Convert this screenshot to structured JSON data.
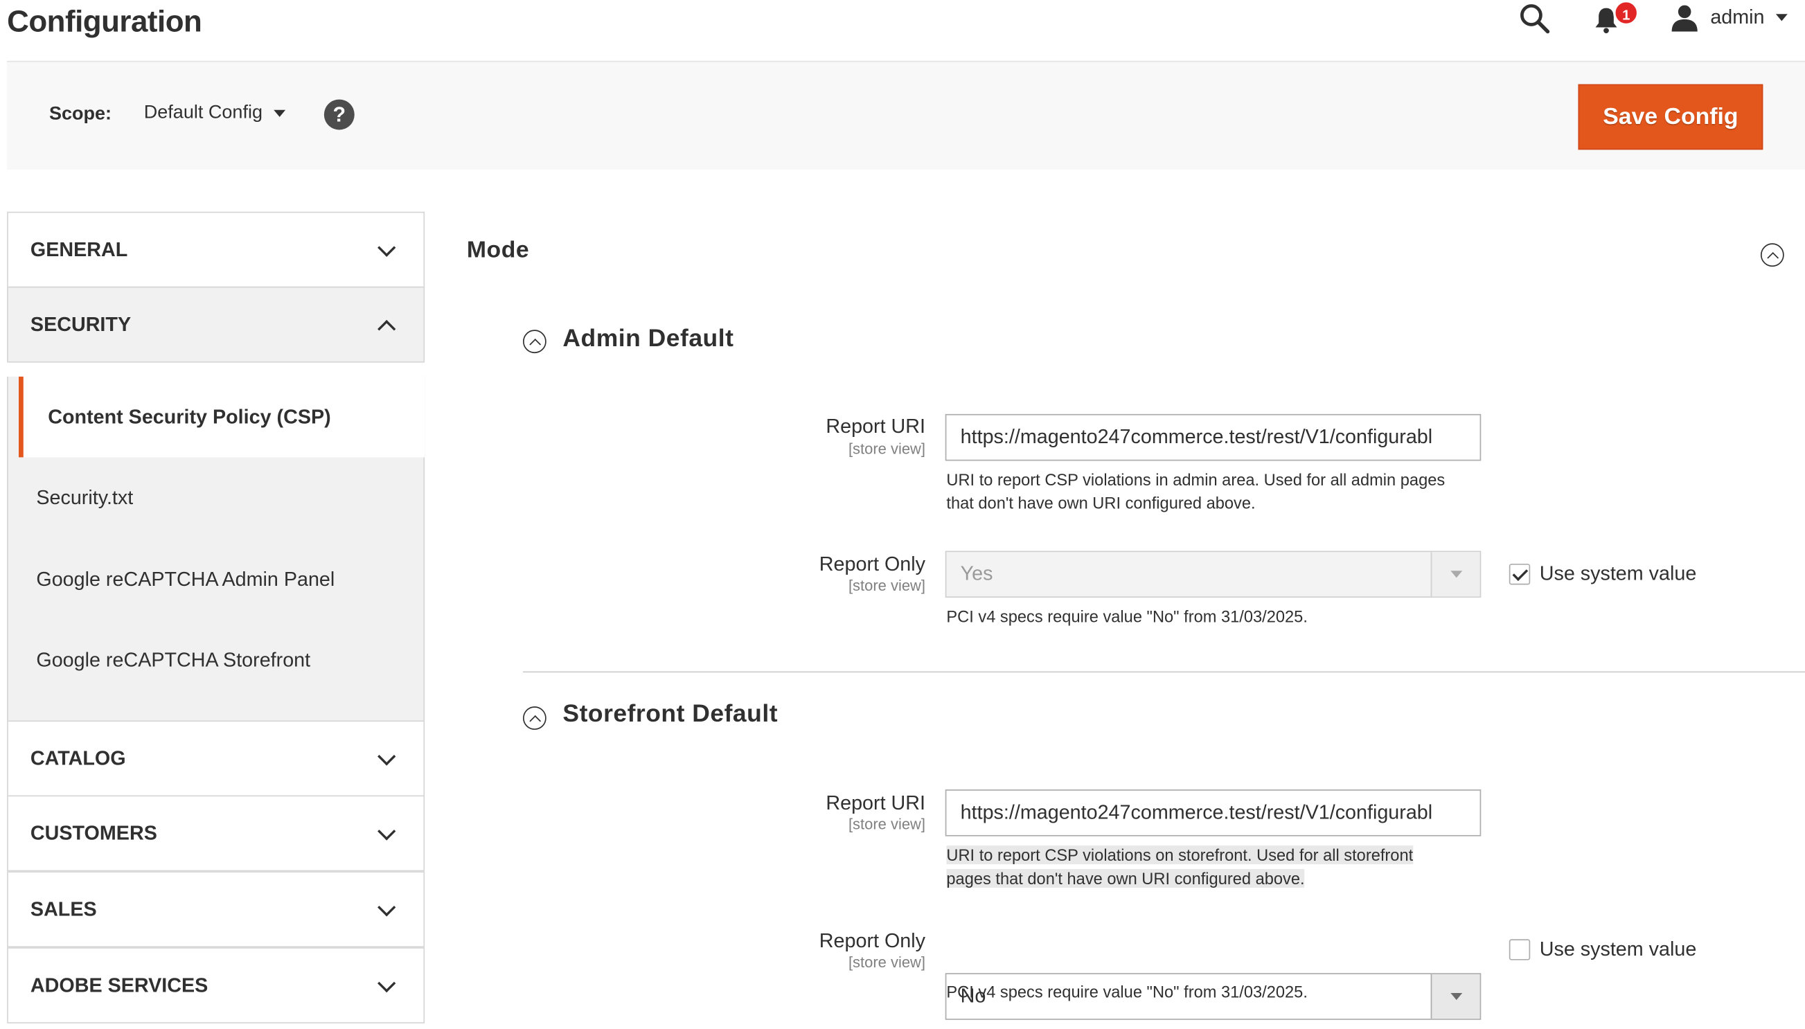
{
  "header": {
    "title": "Configuration",
    "notifications_count": "1",
    "user": "admin"
  },
  "scope": {
    "label": "Scope:",
    "value": "Default Config",
    "help": "?"
  },
  "actions": {
    "save_label": "Save Config"
  },
  "sidebar": {
    "tabs": [
      {
        "label": "GENERAL",
        "expanded": false
      },
      {
        "label": "SECURITY",
        "expanded": true
      },
      {
        "label": "CATALOG",
        "expanded": false
      },
      {
        "label": "CUSTOMERS",
        "expanded": false
      },
      {
        "label": "SALES",
        "expanded": false
      },
      {
        "label": "ADOBE SERVICES",
        "expanded": false
      }
    ],
    "security_items": [
      {
        "label": "Content Security Policy (CSP)",
        "active": true
      },
      {
        "label": "Security.txt",
        "active": false
      },
      {
        "label": "Google reCAPTCHA Admin Panel",
        "active": false
      },
      {
        "label": "Google reCAPTCHA Storefront",
        "active": false
      }
    ]
  },
  "main": {
    "section_title": "Mode",
    "admin": {
      "title": "Admin Default",
      "report_uri": {
        "label": "Report URI",
        "scope": "[store view]",
        "value": "https://magento247commerce.test/rest/V1/configurabl",
        "note_line1": "URI to report CSP violations in admin area. Used for all admin pages",
        "note_line2": "that don't have own URI configured above."
      },
      "report_only": {
        "label": "Report Only",
        "scope": "[store view]",
        "value": "Yes",
        "use_system": "Use system value",
        "use_system_checked": true,
        "note": "PCI v4 specs require value \"No\" from 31/03/2025."
      }
    },
    "storefront": {
      "title": "Storefront Default",
      "report_uri": {
        "label": "Report URI",
        "scope": "[store view]",
        "value": "https://magento247commerce.test/rest/V1/configurabl",
        "note_line1": "URI to report CSP violations on storefront. Used for all storefront",
        "note_line2": "pages that don't have own URI configured above."
      },
      "report_only": {
        "label": "Report Only",
        "scope": "[store view]",
        "value": "No",
        "use_system": "Use system value",
        "use_system_checked": false,
        "note": "PCI v4 specs require value \"No\" from 31/03/2025."
      }
    }
  },
  "colors": {
    "accent": "#e3571c",
    "badge": "#e22626"
  }
}
